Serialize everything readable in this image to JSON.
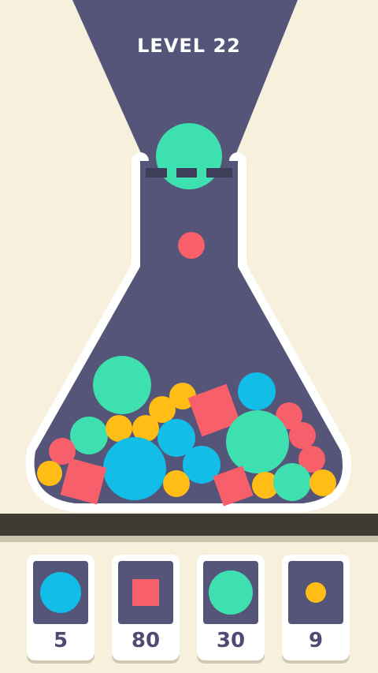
{
  "level": {
    "title": "LEVEL 22"
  },
  "colors": {
    "background": "#f6f0dc",
    "flask": "#555479",
    "beam": "#555479",
    "teal": "#3fe0b0",
    "blue": "#12bde8",
    "red": "#f75f6a",
    "yellow": "#ffbd16",
    "shelf": "#3f3a33"
  },
  "targets": [
    {
      "shape": "circle",
      "color": "blue",
      "size": "large",
      "count": "5"
    },
    {
      "shape": "square",
      "color": "red",
      "size": "medium",
      "count": "80"
    },
    {
      "shape": "circle",
      "color": "teal",
      "size": "large",
      "count": "30"
    },
    {
      "shape": "circle",
      "color": "yellow",
      "size": "small",
      "count": "9"
    }
  ]
}
